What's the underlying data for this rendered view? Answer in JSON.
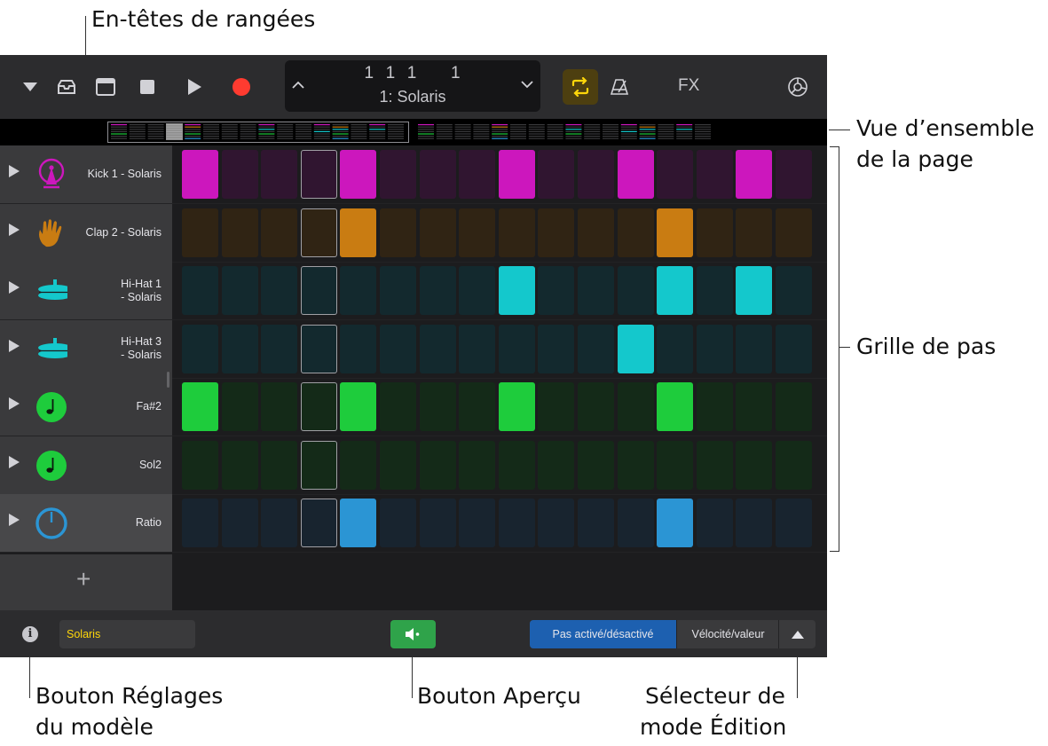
{
  "callouts": {
    "row_headers": "En-têtes de rangées",
    "page_overview_1": "Vue d’ensemble",
    "page_overview_2": "de la page",
    "step_grid": "Grille de pas",
    "pattern_settings_1": "Bouton Réglages",
    "pattern_settings_2": "du modèle",
    "preview": "Bouton Aperçu",
    "edit_mode_1": "Sélecteur de",
    "edit_mode_2": "mode Édition"
  },
  "toolbar": {
    "lcd_position": "1  1  1      1",
    "lcd_name": "1: Solaris",
    "fx_label": "FX",
    "icons": [
      "view-menu-icon",
      "browser-icon",
      "tracks-view-icon",
      "stop-icon",
      "play-icon",
      "record-icon",
      "loop-icon",
      "metronome-icon",
      "settings-icon"
    ]
  },
  "colors": {
    "magenta_on": "#cc17bd",
    "magenta_off": "#301530",
    "orange_on": "#c97c12",
    "orange_off": "#302414",
    "cyan_on": "#14c8cc",
    "cyan_off": "#13292e",
    "green_on": "#1ecc3c",
    "green_off": "#142a18",
    "blue_on": "#2b95d4",
    "blue_off": "#18242f",
    "accent_loop": "#ffd60a",
    "record": "#ff3b30"
  },
  "current_step": 4,
  "rows": [
    {
      "label": "Kick 1 - Solaris",
      "icon": "kick-drum-icon",
      "color": "magenta",
      "steps": [
        1,
        0,
        0,
        0,
        1,
        0,
        0,
        0,
        1,
        0,
        0,
        1,
        0,
        0,
        1,
        0
      ]
    },
    {
      "label": "Clap 2 - Solaris",
      "icon": "clap-hand-icon",
      "color": "orange",
      "steps": [
        0,
        0,
        0,
        0,
        1,
        0,
        0,
        0,
        0,
        0,
        0,
        0,
        1,
        0,
        0,
        0
      ]
    },
    {
      "label": "Hi-Hat 1\n- Solaris",
      "icon": "hi-hat-icon",
      "color": "cyan",
      "steps": [
        0,
        0,
        0,
        0,
        0,
        0,
        0,
        0,
        1,
        0,
        0,
        0,
        1,
        0,
        1,
        0
      ]
    },
    {
      "label": "Hi-Hat 3\n- Solaris",
      "icon": "hi-hat-icon",
      "color": "cyan",
      "steps": [
        0,
        0,
        0,
        0,
        0,
        0,
        0,
        0,
        0,
        0,
        0,
        1,
        0,
        0,
        0,
        0
      ]
    },
    {
      "label": "Fa#2",
      "icon": "note-icon",
      "color": "green",
      "steps": [
        1,
        0,
        0,
        0,
        1,
        0,
        0,
        0,
        1,
        0,
        0,
        0,
        1,
        0,
        0,
        0
      ]
    },
    {
      "label": "Sol2",
      "icon": "note-icon",
      "color": "green",
      "steps": [
        0,
        0,
        0,
        0,
        0,
        0,
        0,
        0,
        0,
        0,
        0,
        0,
        0,
        0,
        0,
        0
      ]
    },
    {
      "label": "Ratio",
      "icon": "knob-icon",
      "color": "blue",
      "selected": true,
      "steps": [
        0,
        0,
        0,
        0,
        1,
        0,
        0,
        0,
        0,
        0,
        0,
        0,
        1,
        0,
        0,
        0
      ]
    }
  ],
  "add_row_label": "+",
  "bottom": {
    "info_label": "i",
    "pattern_name": "Solaris",
    "mode_step_on_off": "Pas activé/désactivé",
    "mode_velocity": "Vélocité/valeur"
  }
}
